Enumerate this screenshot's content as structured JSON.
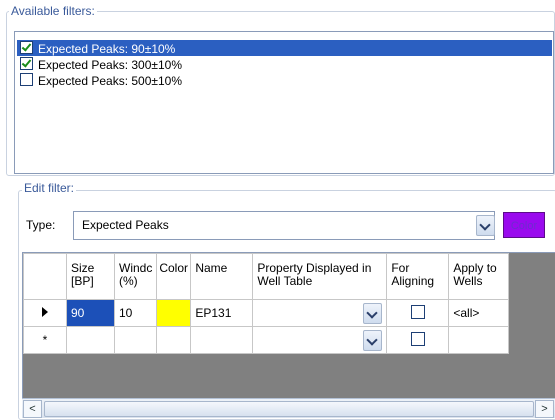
{
  "available_filters": {
    "label": "Available filters:",
    "items": [
      {
        "label": "Expected Peaks: 90±10%",
        "checked": true,
        "selected": true
      },
      {
        "label": "Expected Peaks: 300±10%",
        "checked": true,
        "selected": false
      },
      {
        "label": "Expected Peaks: 500±10%",
        "checked": false,
        "selected": false
      }
    ]
  },
  "edit_filter": {
    "label": "Edit filter:",
    "type_label": "Type:",
    "type_value": "Expected Peaks",
    "color_button": "Color"
  },
  "grid": {
    "columns": [
      "Size [BP]",
      "Windc (%)",
      "Color",
      "Name",
      "Property Displayed in Well Table",
      "For Aligning",
      "Apply to Wells"
    ],
    "rows": [
      {
        "size": "90",
        "window": "10",
        "color": "#ffff00",
        "name": "EP131",
        "property": "",
        "for_aligning": false,
        "apply": "<all>"
      }
    ],
    "new_row_marker": "*"
  },
  "scrollbar": {
    "left": "<",
    "right": ">"
  },
  "colors": {
    "selection": "#2b5fc1",
    "accent_purple": "#9a0aee",
    "swatch": "#ffff00"
  }
}
